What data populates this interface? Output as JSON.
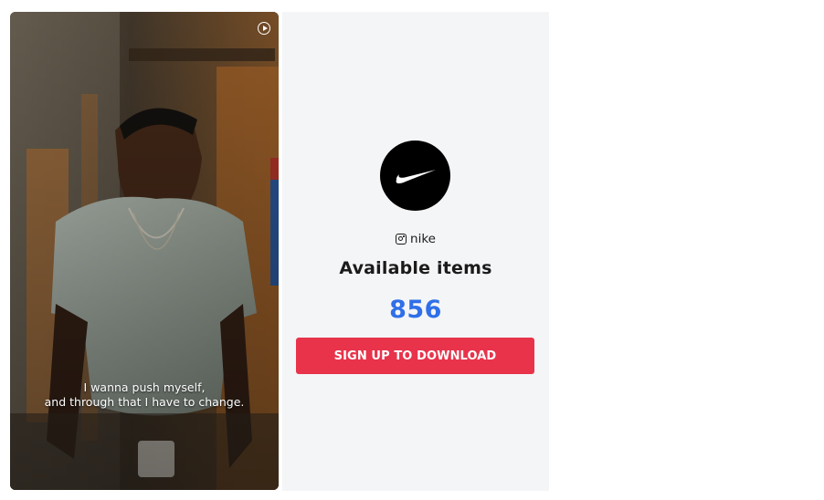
{
  "video": {
    "caption_line1": "I wanna push myself,",
    "caption_line2": "and through that I have to change.",
    "play_icon": "play-circle-icon"
  },
  "profile": {
    "logo_icon": "nike-swoosh-icon",
    "platform_icon": "instagram-icon",
    "handle": "nike",
    "title": "Available items",
    "count": "856",
    "cta_label": "SIGN UP TO DOWNLOAD"
  },
  "colors": {
    "panel_bg": "#f4f5f7",
    "count": "#2f6fe8",
    "cta": "#e8334b"
  }
}
